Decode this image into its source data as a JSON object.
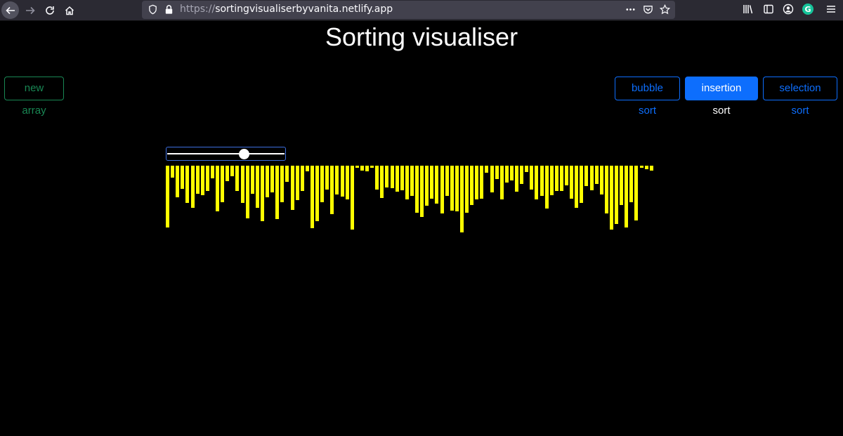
{
  "browser": {
    "url_scheme": "https://",
    "url_host": "sortingvisualiserbyvanita.netlify.app",
    "icons": [
      "back-icon",
      "forward-icon",
      "reload-icon",
      "home-icon",
      "shield-icon",
      "lock-icon",
      "more-icon",
      "pocket-icon",
      "bookmark-star-icon",
      "library-icon",
      "sidebar-icon",
      "account-icon",
      "grammarly-icon",
      "menu-icon"
    ],
    "extension_letter": "G"
  },
  "page": {
    "title": "Sorting visualiser",
    "buttons": {
      "new_array": "new array",
      "bubble_sort": "bubble sort",
      "insertion_sort": "insertion sort",
      "selection_sort": "selection sort"
    },
    "colors": {
      "bar": "#ffff00",
      "primary": "#0d6efd",
      "success": "#198754"
    },
    "slider": {
      "value_fraction": 0.67
    },
    "array": [
      85,
      14,
      42,
      30,
      50,
      57,
      37,
      39,
      33,
      15,
      62,
      49,
      19,
      12,
      33,
      50,
      72,
      37,
      57,
      76,
      42,
      35,
      73,
      49,
      20,
      60,
      46,
      33,
      5,
      86,
      76,
      49,
      31,
      66,
      38,
      41,
      45,
      88,
      0,
      4,
      5,
      0,
      31,
      43,
      28,
      29,
      34,
      32,
      45,
      40,
      64,
      70,
      54,
      44,
      51,
      65,
      40,
      61,
      62,
      92,
      64,
      53,
      45,
      44,
      7,
      35,
      16,
      45,
      21,
      18,
      34,
      23,
      6,
      31,
      45,
      40,
      58,
      39,
      33,
      33,
      25,
      44,
      57,
      50,
      26,
      32,
      23,
      38,
      65,
      88,
      80,
      53,
      85,
      49,
      75,
      0,
      2,
      4
    ]
  }
}
